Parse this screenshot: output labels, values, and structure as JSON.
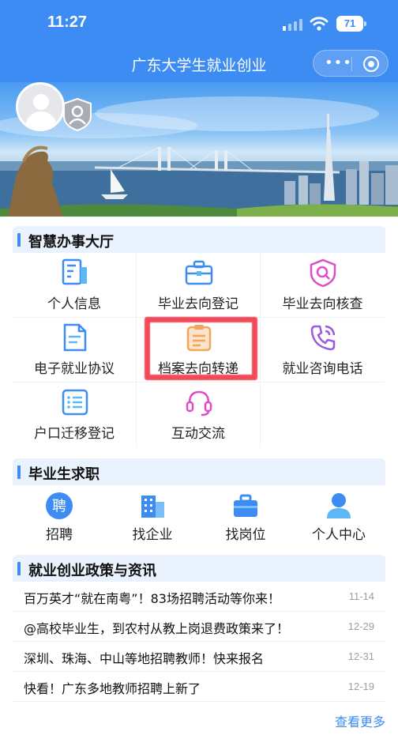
{
  "status": {
    "time": "11:27",
    "battery": "71"
  },
  "nav": {
    "title": "广东大学生就业创业",
    "more": "•••"
  },
  "office": {
    "title": "智慧办事大厅",
    "items": [
      {
        "label": "个人信息",
        "icon": "personal-info-icon"
      },
      {
        "label": "毕业去向登记",
        "icon": "briefcase-icon"
      },
      {
        "label": "毕业去向核查",
        "icon": "shield-search-icon"
      },
      {
        "label": "电子就业协议",
        "icon": "document-icon"
      },
      {
        "label": "档案去向转递",
        "icon": "clipboard-icon"
      },
      {
        "label": "就业咨询电话",
        "icon": "phone-icon"
      },
      {
        "label": "户口迁移登记",
        "icon": "list-icon"
      },
      {
        "label": "互动交流",
        "icon": "headset-icon"
      }
    ]
  },
  "jobs": {
    "title": "毕业生求职",
    "items": [
      {
        "label": "招聘",
        "glyph": "聘",
        "icon": "recruit-icon"
      },
      {
        "label": "找企业",
        "icon": "building-icon"
      },
      {
        "label": "找岗位",
        "icon": "briefcase-icon"
      },
      {
        "label": "个人中心",
        "icon": "user-icon"
      }
    ]
  },
  "news": {
    "title": "就业创业政策与资讯",
    "items": [
      {
        "title": "百万英才“就在南粤”！83场招聘活动等你来！",
        "date": "11-14"
      },
      {
        "title": "@高校毕业生，到农村从教上岗退费政策来了！",
        "date": "12-29"
      },
      {
        "title": "深圳、珠海、中山等地招聘教师！快来报名",
        "date": "12-31"
      },
      {
        "title": "快看！广东多地教师招聘上新了",
        "date": "12-19"
      }
    ],
    "more": "查看更多"
  },
  "colors": {
    "primary": "#3c8cf3",
    "highlight": "#f02a3e"
  }
}
